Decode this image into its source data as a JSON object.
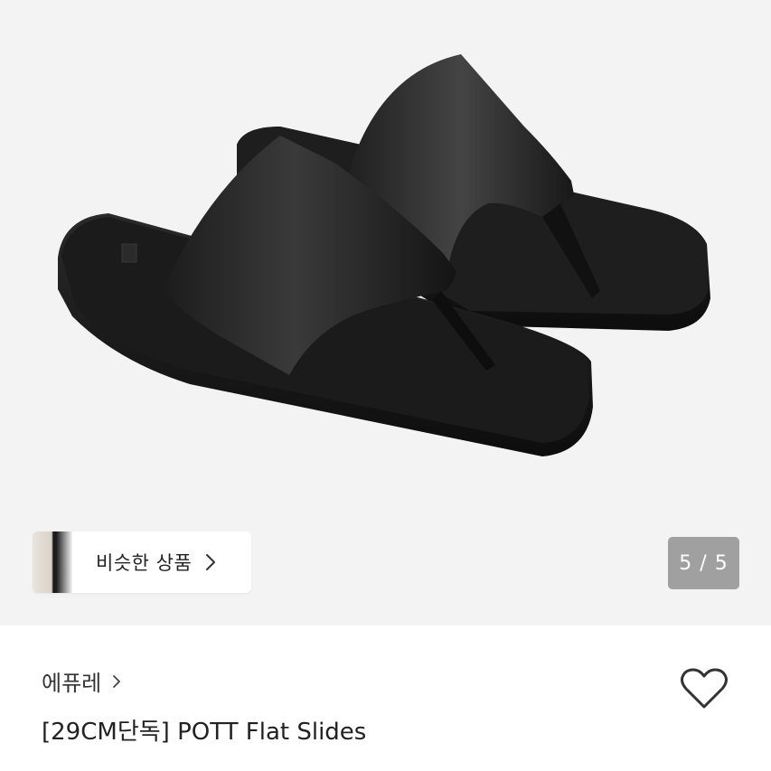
{
  "gallery": {
    "similar_label": "비슷한 상품",
    "counter": "5 / 5"
  },
  "product": {
    "brand": "에퓨레",
    "title": "[29CM단독] POTT Flat Slides"
  },
  "icons": {
    "similar_chevron": "chevron-right-icon",
    "brand_chevron": "chevron-right-icon",
    "wishlist": "heart-outline-icon"
  },
  "colors": {
    "hero_background": "#f3f3f3",
    "counter_background": "#808080",
    "text_primary": "#222222"
  }
}
